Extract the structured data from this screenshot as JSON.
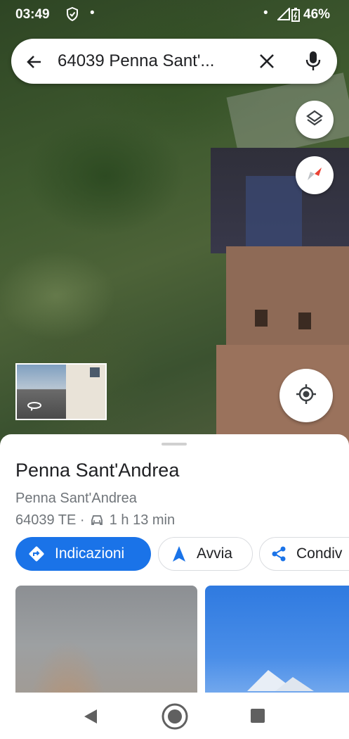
{
  "status_bar": {
    "time": "03:49",
    "battery": "46%"
  },
  "search": {
    "query": "64039 Penna Sant'..."
  },
  "place": {
    "title": "Penna Sant'Andrea",
    "subtitle": "Penna Sant'Andrea",
    "postal": "64039 TE ·",
    "drive_time": "1 h 13 min"
  },
  "actions": {
    "directions": "Indicazioni",
    "start": "Avvia",
    "share": "Condiv"
  },
  "colors": {
    "accent": "#1a73e8",
    "compass_red": "#ea4335"
  }
}
